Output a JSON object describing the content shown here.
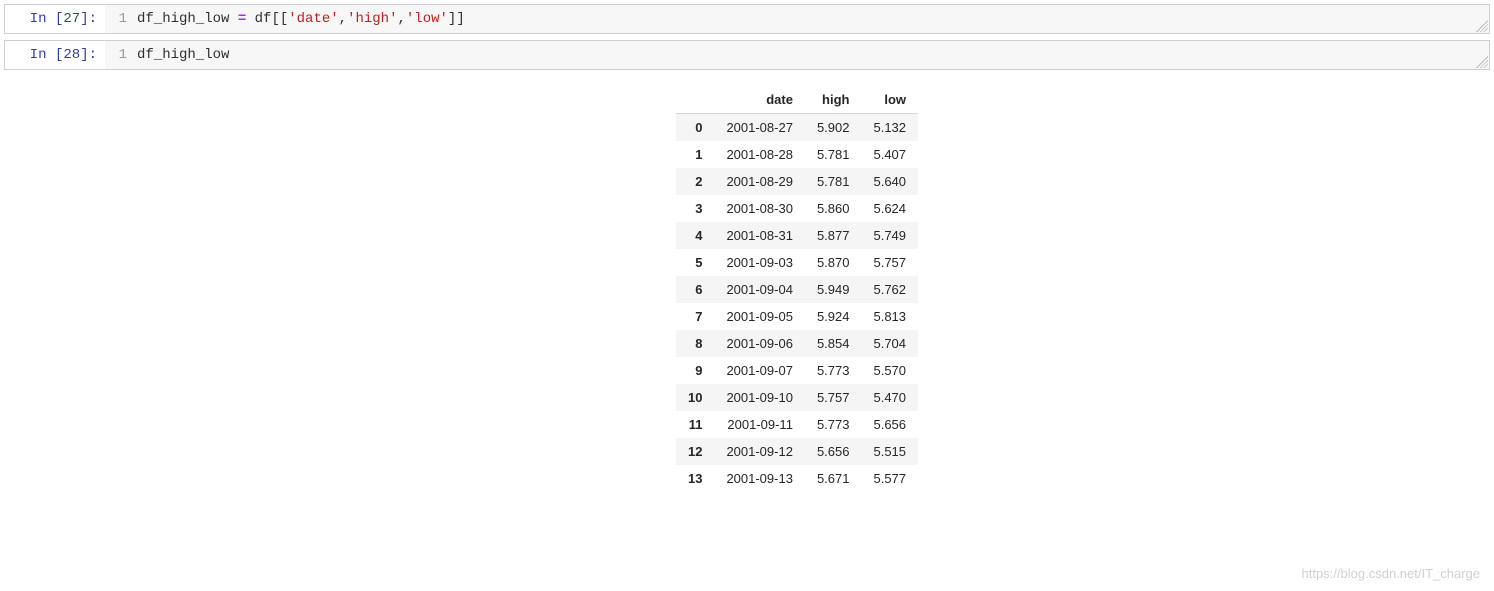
{
  "cells": [
    {
      "prompt": "In [27]:",
      "line_no": "1",
      "code_tokens": [
        {
          "t": "id",
          "v": "df_high_low "
        },
        {
          "t": "op",
          "v": "="
        },
        {
          "t": "id",
          "v": " df[["
        },
        {
          "t": "str",
          "v": "'date'"
        },
        {
          "t": "id",
          "v": ","
        },
        {
          "t": "str",
          "v": "'high'"
        },
        {
          "t": "id",
          "v": ","
        },
        {
          "t": "str",
          "v": "'low'"
        },
        {
          "t": "id",
          "v": "]]"
        }
      ]
    },
    {
      "prompt": "In [28]:",
      "line_no": "1",
      "code_tokens": [
        {
          "t": "id",
          "v": "df_high_low"
        }
      ]
    }
  ],
  "dataframe": {
    "columns": [
      "date",
      "high",
      "low"
    ],
    "rows": [
      {
        "idx": "0",
        "date": "2001-08-27",
        "high": "5.902",
        "low": "5.132"
      },
      {
        "idx": "1",
        "date": "2001-08-28",
        "high": "5.781",
        "low": "5.407"
      },
      {
        "idx": "2",
        "date": "2001-08-29",
        "high": "5.781",
        "low": "5.640"
      },
      {
        "idx": "3",
        "date": "2001-08-30",
        "high": "5.860",
        "low": "5.624"
      },
      {
        "idx": "4",
        "date": "2001-08-31",
        "high": "5.877",
        "low": "5.749"
      },
      {
        "idx": "5",
        "date": "2001-09-03",
        "high": "5.870",
        "low": "5.757"
      },
      {
        "idx": "6",
        "date": "2001-09-04",
        "high": "5.949",
        "low": "5.762"
      },
      {
        "idx": "7",
        "date": "2001-09-05",
        "high": "5.924",
        "low": "5.813"
      },
      {
        "idx": "8",
        "date": "2001-09-06",
        "high": "5.854",
        "low": "5.704"
      },
      {
        "idx": "9",
        "date": "2001-09-07",
        "high": "5.773",
        "low": "5.570"
      },
      {
        "idx": "10",
        "date": "2001-09-10",
        "high": "5.757",
        "low": "5.470"
      },
      {
        "idx": "11",
        "date": "2001-09-11",
        "high": "5.773",
        "low": "5.656"
      },
      {
        "idx": "12",
        "date": "2001-09-12",
        "high": "5.656",
        "low": "5.515"
      },
      {
        "idx": "13",
        "date": "2001-09-13",
        "high": "5.671",
        "low": "5.577"
      }
    ]
  },
  "watermark": "https://blog.csdn.net/IT_charge"
}
